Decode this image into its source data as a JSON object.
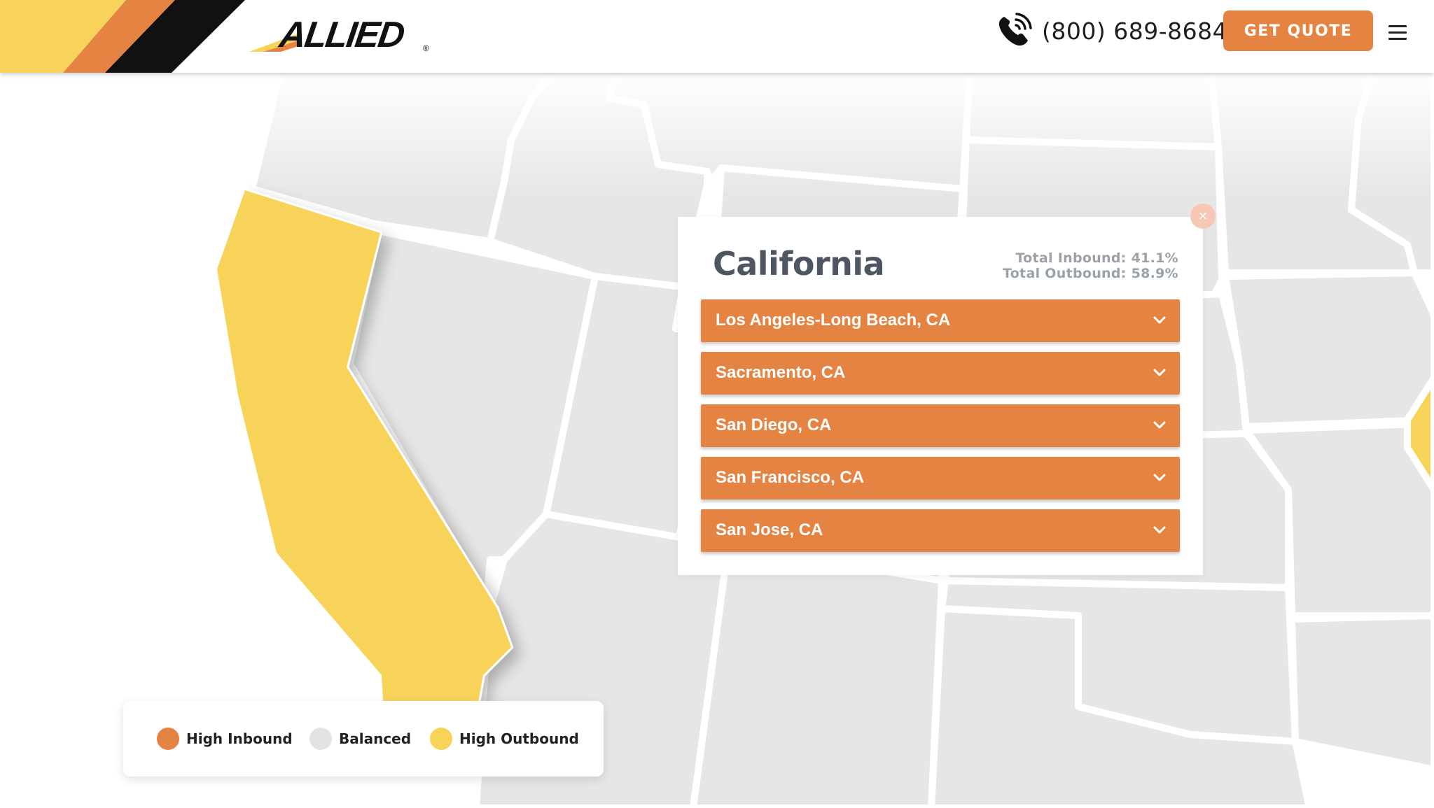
{
  "header": {
    "logo_text": "ALLIED",
    "phone_number": "(800) 689-8684",
    "quote_label": "GET QUOTE"
  },
  "popup": {
    "state_name": "California",
    "total_inbound": "Total Inbound: 41.1%",
    "total_outbound": "Total Outbound: 58.9%",
    "close_glyph": "×",
    "cities": [
      "Los Angeles-Long Beach, CA",
      "Sacramento, CA",
      "San Diego, CA",
      "San Francisco, CA",
      "San Jose, CA"
    ]
  },
  "legend": {
    "items": [
      {
        "label": "High Inbound",
        "color": "#e48342"
      },
      {
        "label": "Balanced",
        "color": "#e3e3e3"
      },
      {
        "label": "High Outbound",
        "color": "#f7d35a"
      }
    ]
  },
  "map": {
    "highlighted_state": "California",
    "highlight_color": "#f7d35a",
    "base_state_color": "#e6e6e6",
    "border_color": "#ffffff"
  },
  "colors": {
    "accent_orange": "#e48342",
    "accent_yellow": "#f7d35a",
    "title_gray": "#4e5661",
    "stats_gray": "#9aa1a9"
  },
  "icons": {
    "phone": "phone-icon",
    "menu": "hamburger-menu-icon",
    "close": "close-icon",
    "chevron": "chevron-down-icon"
  }
}
